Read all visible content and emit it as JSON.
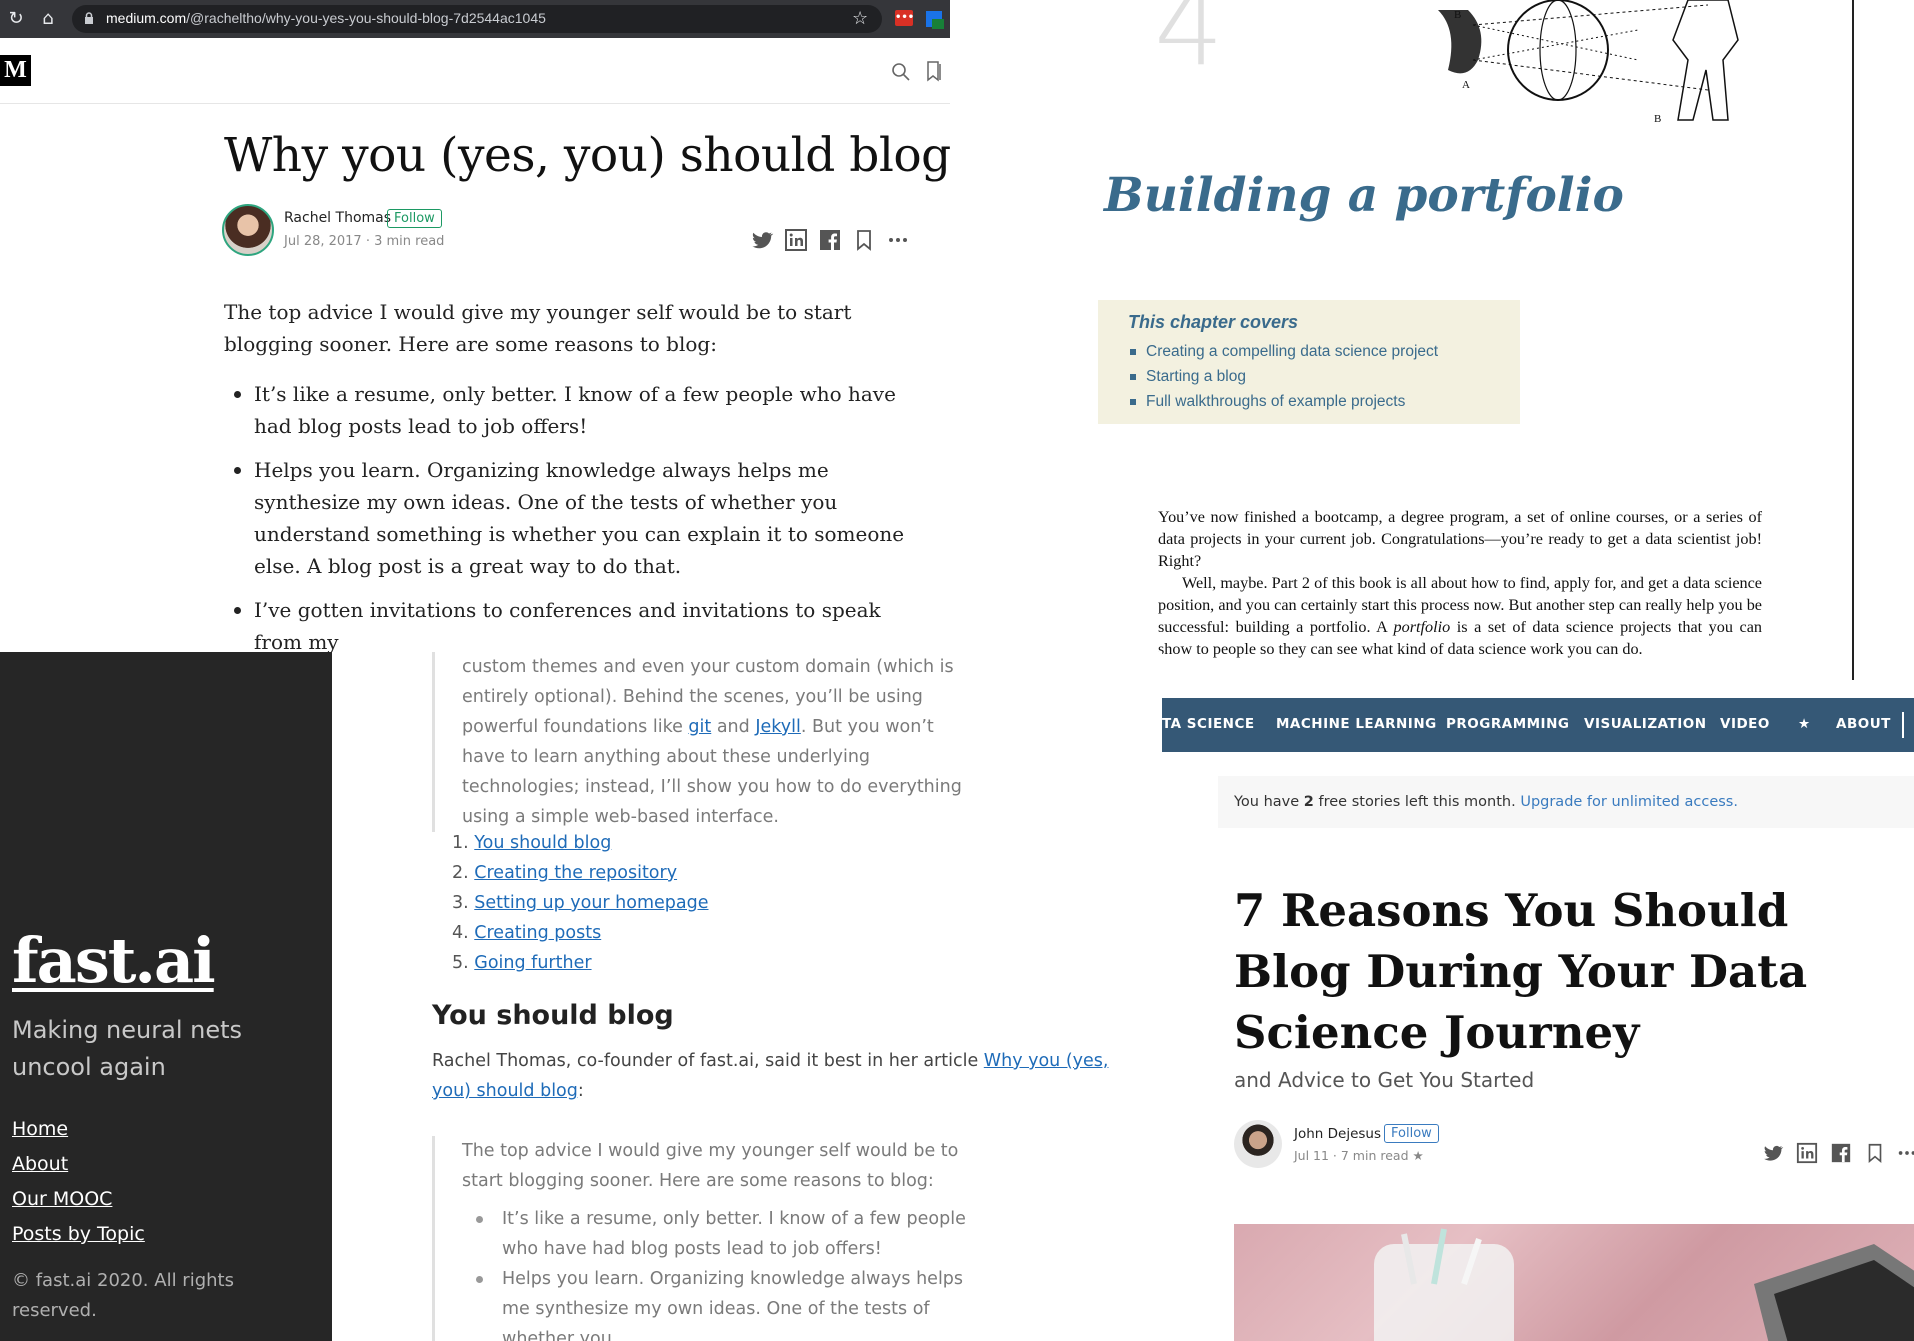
{
  "medium": {
    "url_host": "medium.com",
    "url_path": "/@racheltho/why-you-yes-you-should-blog-7d2544ac1045",
    "logo": "M",
    "title": "Why you (yes, you) should blog",
    "author": "Rachel Thomas",
    "follow": "Follow",
    "meta": "Jul 28, 2017 · 3 min read",
    "intro": "The top advice I would give my younger self would be to start blogging sooner. Here are some reasons to blog:",
    "bullets": [
      "It’s like a resume, only better. I know of a few people who have had blog posts lead to job offers!",
      "Helps you learn. Organizing knowledge always helps me synthesize my own ideas. One of the tests of whether you understand something is whether you can explain it to someone else. A blog post is a great way to do that.",
      "I’ve gotten invitations to conferences and invitations to speak from my"
    ],
    "icons": [
      "twitter-icon",
      "linkedin-icon",
      "facebook-icon",
      "bookmark-icon",
      "more-icon"
    ]
  },
  "book": {
    "chapter_number": "4",
    "chapter_title": "Building a portfolio",
    "covers_heading": "This chapter covers",
    "covers_items": [
      "Creating a compelling data science project",
      "Starting a blog",
      "Full walkthroughs of example projects"
    ],
    "para1": "You’ve now finished a bootcamp, a degree program, a set of online courses, or a series of data projects in your current job. Congratulations—you’re ready to get a data scientist job! Right?",
    "para2_a": "Well, maybe. Part 2 of this book is all about how to find, apply for, and get a data science position, and you can certainly start this process now. But another step can really help you be successful: building a portfolio. A ",
    "para2_em": "portfolio",
    "para2_b": " is a set of data science projects that you can show to people so they can see what kind of data science work you can do.",
    "engraving_labels": [
      "B",
      "A",
      "B"
    ]
  },
  "fastai_sidebar": {
    "logo": "fast.ai",
    "tagline": "Making neural nets uncool again",
    "links": [
      "Home",
      "About",
      "Our MOOC",
      "Posts by Topic"
    ],
    "copyright": "© fast.ai 2020. All rights reserved."
  },
  "fastai_article": {
    "bq1_a": "custom themes and even your custom domain (which is entirely optional). Behind the scenes, you’ll be using powerful foundations like ",
    "bq1_git": "git",
    "bq1_and": " and ",
    "bq1_jekyll": "Jekyll",
    "bq1_b": ". But you won’t have to learn anything about these underlying technologies; instead, I’ll show you how to do everything using a simple web-based interface.",
    "toc": [
      {
        "num": "1.",
        "label": "You should blog"
      },
      {
        "num": "2.",
        "label": "Creating the repository"
      },
      {
        "num": "3.",
        "label": "Setting up your homepage"
      },
      {
        "num": "4.",
        "label": "Creating posts"
      },
      {
        "num": "5.",
        "label": "Going further"
      }
    ],
    "heading": "You should blog",
    "para_a": "Rachel Thomas, co-founder of fast.ai, said it best in her article ",
    "para_link": "Why you (yes, you) should blog",
    "para_b": ":",
    "bq2_intro": "The top advice I would give my younger self would be to start blogging sooner. Here are some reasons to blog:",
    "bq2_items": [
      "It’s like a resume, only better. I know of a few people who have had blog posts lead to job offers!",
      "Helps you learn. Organizing knowledge always helps me synthesize my own ideas. One of the tests of whether you"
    ]
  },
  "tds": {
    "nav": [
      "TA SCIENCE",
      "MACHINE LEARNING",
      "PROGRAMMING",
      "VISUALIZATION",
      "VIDEO",
      "★",
      "ABOUT"
    ],
    "banner_a": "You have ",
    "banner_count": "2",
    "banner_b": " free stories left this month. ",
    "banner_link": "Upgrade for unlimited access.",
    "title": "7 Reasons You Should Blog During Your Data Science Journey",
    "subtitle": "and Advice to Get You Started",
    "author": "John Dejesus",
    "follow": "Follow",
    "meta": "Jul 11 · 7 min read ★",
    "nav_color": "#355876"
  }
}
